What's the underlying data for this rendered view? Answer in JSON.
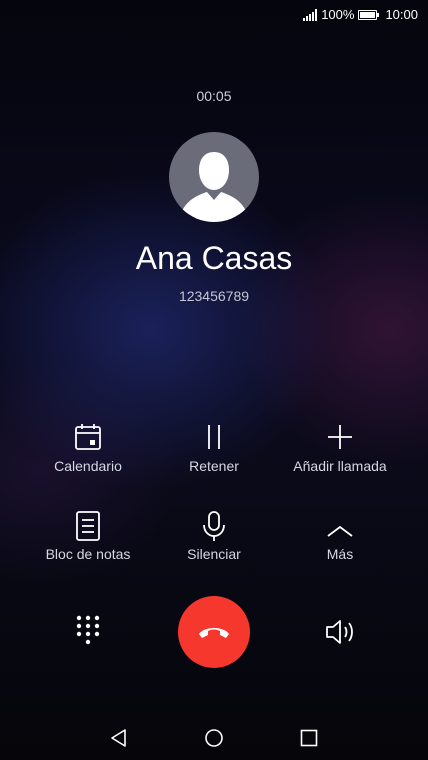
{
  "status_bar": {
    "battery_percent": "100%",
    "time": "10:00",
    "signal_icon": "signal-icon",
    "battery_icon": "battery-icon"
  },
  "call": {
    "duration": "00:05",
    "name": "Ana Casas",
    "number": "123456789",
    "avatar_icon": "person-icon"
  },
  "actions": [
    {
      "label": "Calendario",
      "icon": "calendar-icon"
    },
    {
      "label": "Retener",
      "icon": "pause-icon"
    },
    {
      "label": "Añadir llamada",
      "icon": "plus-icon"
    },
    {
      "label": "Bloc de notas",
      "icon": "notes-icon"
    },
    {
      "label": "Silenciar",
      "icon": "microphone-icon"
    },
    {
      "label": "Más",
      "icon": "chevron-up-icon"
    }
  ],
  "controls": {
    "keypad_icon": "keypad-icon",
    "end_call_icon": "end-call-icon",
    "speaker_icon": "speaker-icon"
  },
  "nav": {
    "back_icon": "back-icon",
    "home_icon": "home-icon",
    "recents_icon": "recents-icon"
  },
  "colors": {
    "end_call": "#f5372d",
    "text_secondary": "#d6d7e2"
  }
}
